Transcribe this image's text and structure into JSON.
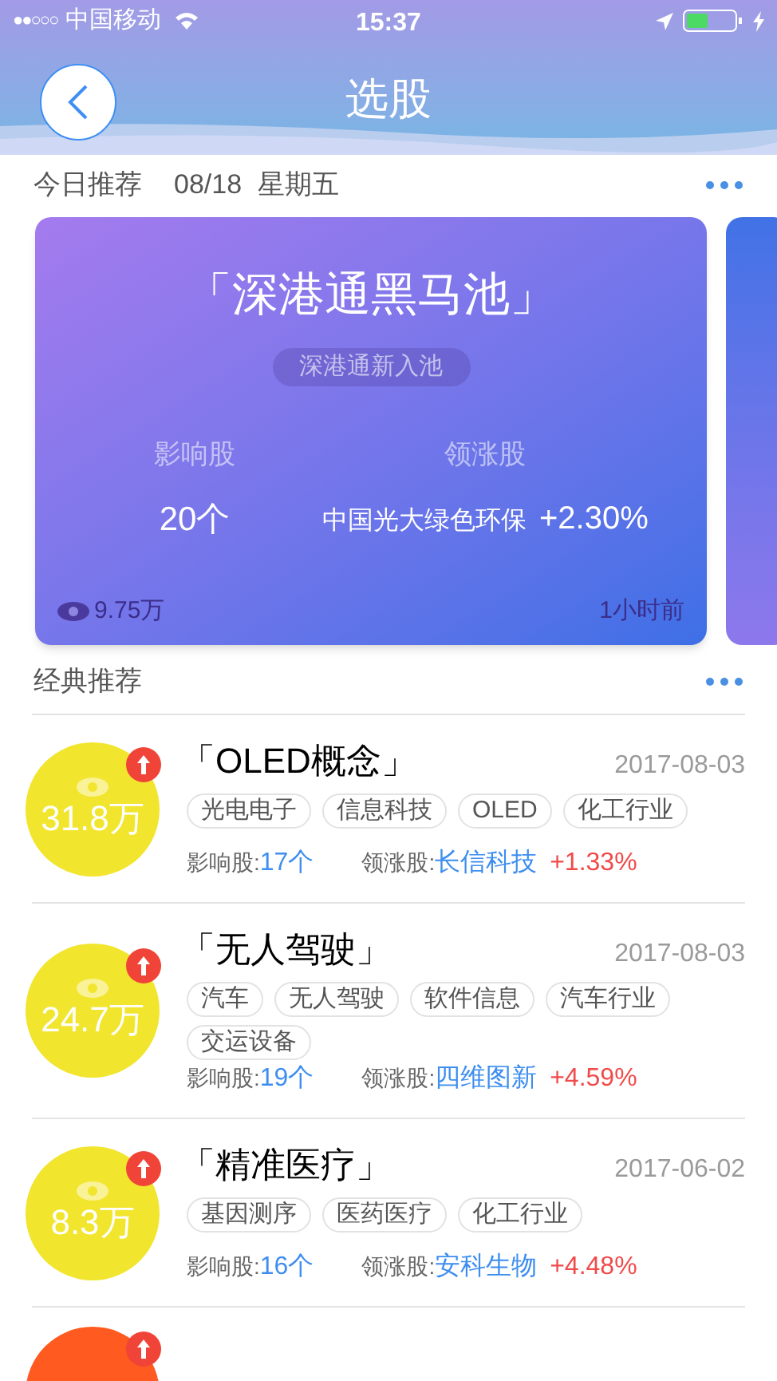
{
  "status_bar": {
    "signal": "●●○○○",
    "carrier": "中国移动",
    "time": "15:37"
  },
  "header": {
    "title": "选股"
  },
  "today": {
    "label": "今日推荐",
    "date": "08/18",
    "weekday": "星期五"
  },
  "card": {
    "title": "「深港通黑马池」",
    "subtitle": "深港通新入池",
    "stat_1_label": "影响股",
    "stat_1_value": "20个",
    "stat_2_label": "领涨股",
    "stat_2_stock": "中国光大绿色环保",
    "stat_2_change": "+2.30%",
    "views": "9.75万",
    "time": "1小时前"
  },
  "classic": {
    "label": "经典推荐"
  },
  "rows": [
    {
      "color": "#f2e52e",
      "trending": true,
      "views": "31.8万",
      "title": "「OLED概念」",
      "date": "2017-08-03",
      "tags": [
        "光电电子",
        "信息科技",
        "OLED",
        "化工行业"
      ],
      "affected_label": "影响股:",
      "affected": "17个",
      "leader_label": "领涨股:",
      "leader": "长信科技",
      "change": "+1.33%"
    },
    {
      "color": "#f2e52e",
      "trending": true,
      "views": "24.7万",
      "title": "「无人驾驶」",
      "date": "2017-08-03",
      "tags": [
        "汽车",
        "无人驾驶",
        "软件信息",
        "汽车行业",
        "交运设备"
      ],
      "affected_label": "影响股:",
      "affected": "19个",
      "leader_label": "领涨股:",
      "leader": "四维图新",
      "change": "+4.59%"
    },
    {
      "color": "#f2e52e",
      "trending": true,
      "views": "8.3万",
      "title": "「精准医疗」",
      "date": "2017-06-02",
      "tags": [
        "基因测序",
        "医药医疗",
        "化工行业"
      ],
      "affected_label": "影响股:",
      "affected": "16个",
      "leader_label": "领涨股:",
      "leader": "安科生物",
      "change": "+4.48%"
    },
    {
      "color": "#ff5a1f",
      "trending": true
    }
  ]
}
